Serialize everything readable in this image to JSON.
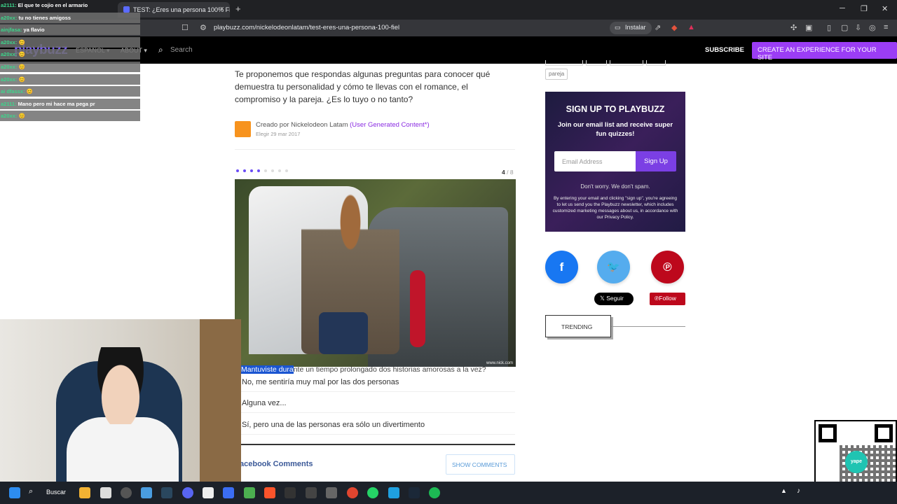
{
  "browser": {
    "tab_title": "TEST: ¿Eres una persona 100% Fi...",
    "tab_close": "×",
    "new_tab": "+",
    "url": "playbuzz.com/nickelodeonlatam/test-eres-una-persona-100-fiel",
    "install_label": "Instalar",
    "minimize": "─",
    "maximize": "❐",
    "close": "✕"
  },
  "site": {
    "logo": "playbuzz",
    "nav_lang": "ESPAÑOL ▾",
    "nav_about": "ABOUT ▾",
    "search_placeholder": "Search",
    "subscribe": "SUBSCRIBE",
    "create": "CREATE AN EXPERIENCE FOR YOUR SITE"
  },
  "article": {
    "intro": "Te proponemos que respondas algunas preguntas para conocer qué demuestra tu personalidad y cómo te llevas con el romance, el compromiso y la pareja. ¿Es lo tuyo o no tanto?",
    "author_prefix": "Creado por Nickelodeon Latam",
    "author_ugc": "(User Generated Content*)",
    "date": "Elegir 29 mar 2017",
    "progress_current": "4",
    "progress_total": " / 8",
    "progress_value": 4,
    "progress_count": 8,
    "watermark": "www.nick.com",
    "question_highlight": "Mantuviste dura",
    "question_rest": "nte un tiempo prolongado dos historias amorosas a la vez?",
    "answers": [
      "No, me sentiría muy mal por las dos personas",
      "Alguna vez...",
      "Sí, pero una de las personas era sólo un divertimento"
    ],
    "facebook_comments": "acebook Comments",
    "show_comments": "SHOW COMMENTS"
  },
  "sidebar": {
    "tag": "pareja",
    "signup_title": "SIGN UP TO PLAYBUZZ",
    "signup_text": "Join our email list and receive super fun quizzes!",
    "email_placeholder": "Email Address",
    "signup_button": "Sign Up",
    "no_spam": "Don't worry. We don't spam.",
    "legal": "By entering your email and clicking \"sign up\", you're agreeing to let us send you the Playbuzz newsletter, which includes customized marketing messages about us, in accordance with our Privacy Policy.",
    "x_follow": "Seguir",
    "pin_follow": "Follow",
    "trending": "TRENDING",
    "facebook_glyph": "f",
    "twitter_glyph": "🐦",
    "pinterest_glyph": "℗"
  },
  "chat": [
    {
      "user": "a2111:",
      "text": " El que te cojio en el armario"
    },
    {
      "user": "a20xx:",
      "text": " tu no tienes amigoss"
    },
    {
      "user": "ainjfasa:",
      "text": " ya flavio"
    },
    {
      "user": "a20xx:",
      "text": " 😊"
    },
    {
      "user": "a20xx:",
      "text": " 😊"
    },
    {
      "user": "a20xx:",
      "text": " 😊"
    },
    {
      "user": "a20xx:",
      "text": " 😊"
    },
    {
      "user": "ai dfassx:",
      "text": " 😊"
    },
    {
      "user": "a2111:",
      "text": " Mano pero mi hace ma pega pr"
    },
    {
      "user": "a20xx:",
      "text": " 😊"
    }
  ],
  "taskbar": {
    "search": "Buscar",
    "qr_brand": "yape"
  },
  "colors": {
    "accent": "#9b3df5",
    "facebook": "#1877f2",
    "twitter": "#55acee",
    "pinterest": "#bd081c"
  }
}
